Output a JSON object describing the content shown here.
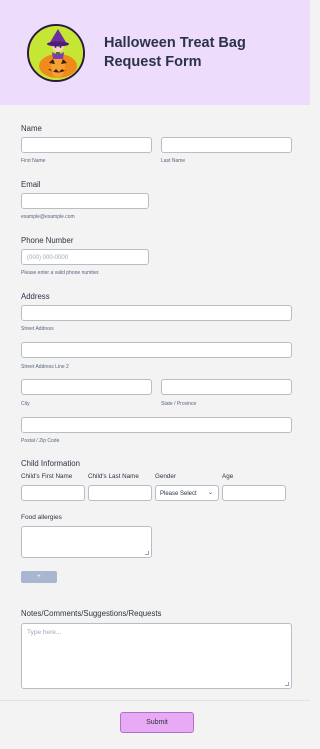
{
  "header": {
    "title": "Halloween Treat Bag Request Form"
  },
  "name": {
    "label": "Name",
    "first_sub": "First Name",
    "last_sub": "Last Name"
  },
  "email": {
    "label": "Email",
    "sub": "example@example.com"
  },
  "phone": {
    "label": "Phone Number",
    "placeholder": "(000) 000-0000",
    "sub": "Please enter a valid phone number."
  },
  "address": {
    "label": "Address",
    "street_sub": "Street Address",
    "street2_sub": "Street Address Line 2",
    "city_sub": "City",
    "state_sub": "State / Province",
    "zip_sub": "Postal / Zip Code"
  },
  "child": {
    "label": "Child Information",
    "columns": [
      "Child's First Name",
      "Child's Last Name",
      "Gender",
      "Age"
    ],
    "gender_value": "Please Select"
  },
  "allergies": {
    "label": "Food allergies"
  },
  "add_button": {
    "label": "+"
  },
  "notes": {
    "label": "Notes/Comments/Suggestions/Requests",
    "placeholder": "Type here..."
  },
  "submit": {
    "label": "Submit"
  },
  "colors": {
    "header_bg": "#eddcfc",
    "submit_bg": "#e8a9f5",
    "add_button_bg": "#a9b6d0"
  },
  "icons": {
    "logo": "witch-pumpkin-logo-icon",
    "chevron": "chevron-down-icon"
  }
}
